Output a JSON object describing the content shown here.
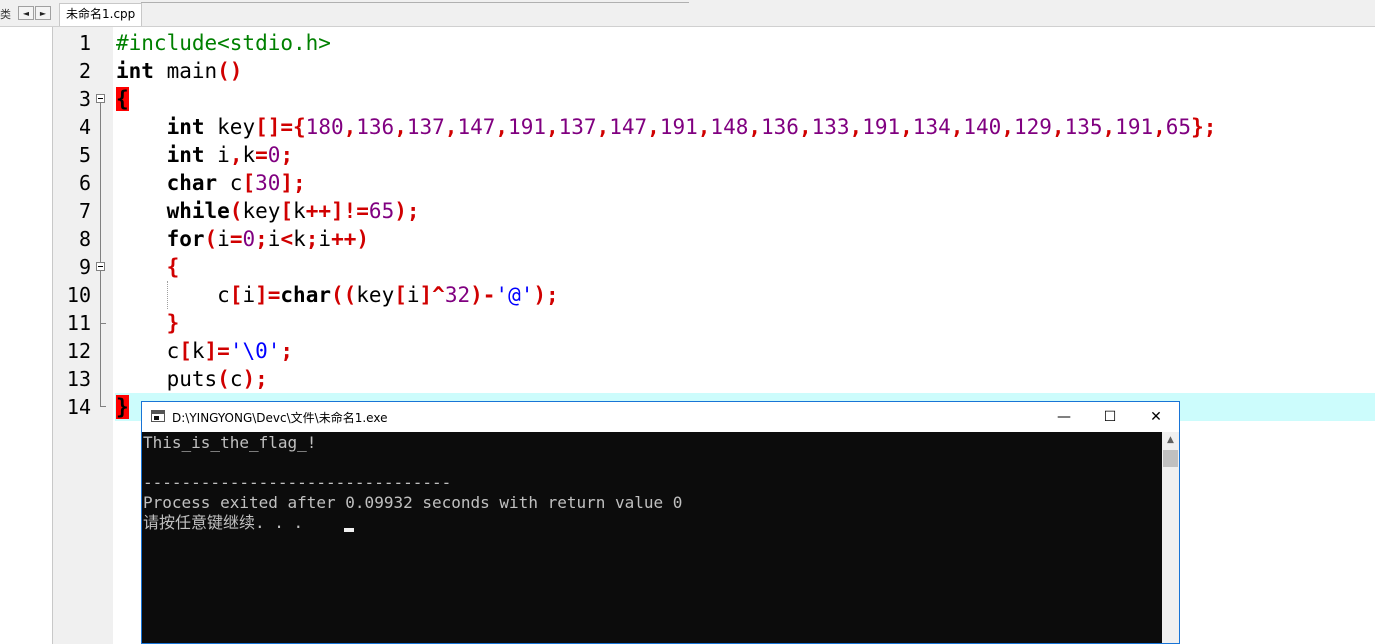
{
  "window": {
    "left_tab_fragment": "类",
    "nav_prev": "◄",
    "nav_next": "►"
  },
  "editor": {
    "tab_label": "未命名1.cpp",
    "line_numbers": [
      "1",
      "2",
      "3",
      "4",
      "5",
      "6",
      "7",
      "8",
      "9",
      "10",
      "11",
      "12",
      "13",
      "14"
    ]
  },
  "console": {
    "title": "D:\\YINGYONG\\Devc\\文件\\未命名1.exe",
    "minimize": "—",
    "maximize": "☐",
    "close": "✕",
    "lines": [
      "This_is_the_flag_!",
      "",
      "--------------------------------",
      "Process exited after 0.09932 seconds with return value 0",
      "请按任意键继续. . ."
    ]
  }
}
